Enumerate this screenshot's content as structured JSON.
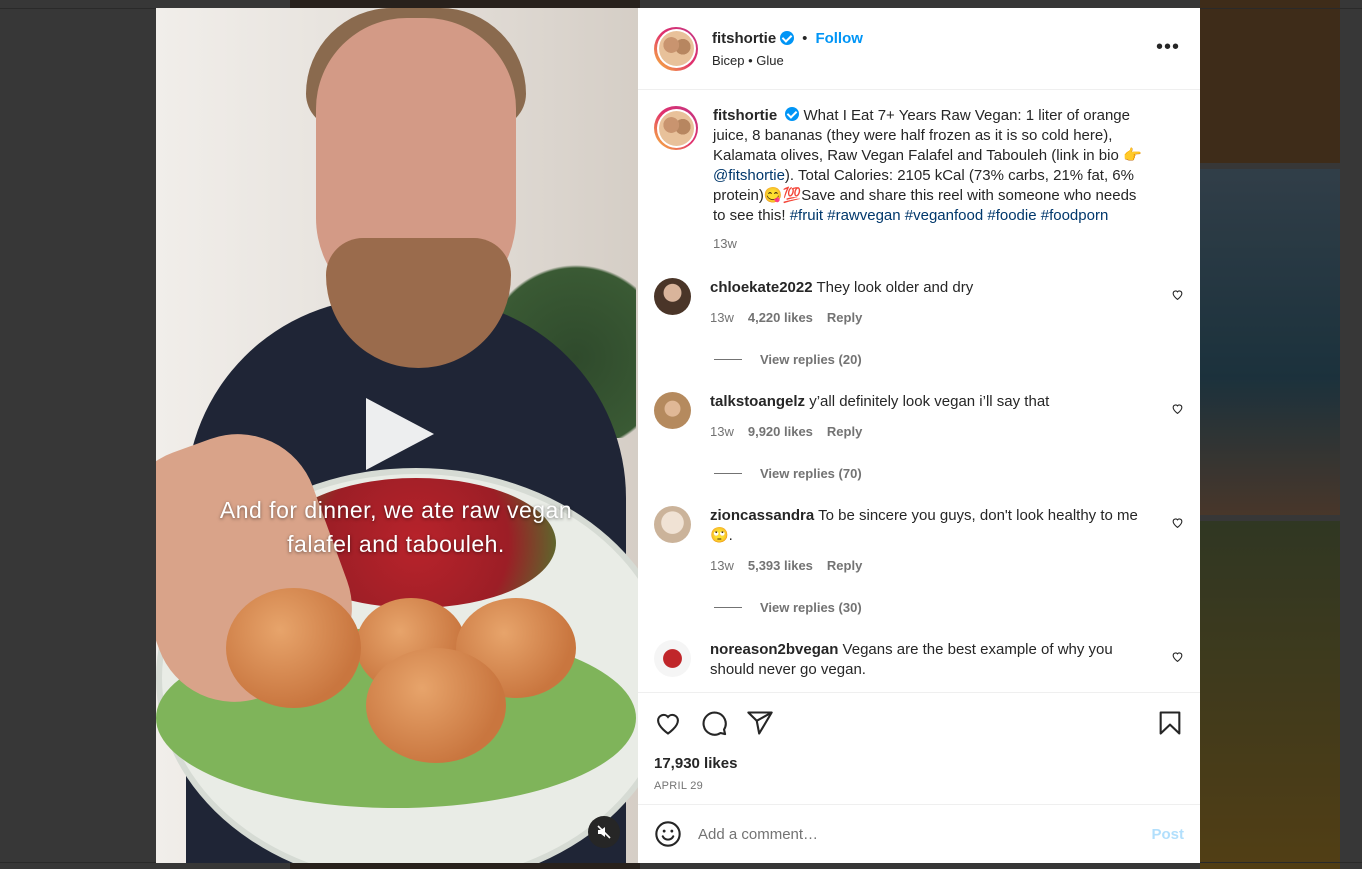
{
  "post": {
    "username": "fitshortie",
    "follow_label": "Follow",
    "separator": "•",
    "audio": "Bicep • Glue",
    "more_label": "•••",
    "video_caption": "And for dinner, we ate raw vegan falafel and tabouleh.",
    "caption_parts": {
      "text1": "What I Eat 7+ Years Raw Vegan: 1 liter of orange juice, 8 bananas (they were half frozen as it is so cold here), Kalamata olives, Raw Vegan Falafel and Tabouleh (link in bio 👉 ",
      "mention": "@fitshortie",
      "text2": "). Total Calories: 2105 kCal (73% carbs, 21% fat, 6% protein)😋💯Save and share this reel with someone who needs to see this! ",
      "hashtags": "#fruit #rawvegan #veganfood #foodie #foodporn"
    },
    "caption_time": "13w",
    "likes": "17,930 likes",
    "date": "APRIL 29"
  },
  "comments": [
    {
      "username": "chloekate2022",
      "text": "They look older and dry",
      "time": "13w",
      "likes": "4,220 likes",
      "reply": "Reply",
      "view_replies": "View replies (20)",
      "avatar_color": "#8c6d5b"
    },
    {
      "username": "talkstoangelz",
      "text": "y’all definitely look vegan i’ll say that",
      "time": "13w",
      "likes": "9,920 likes",
      "reply": "Reply",
      "view_replies": "View replies (70)",
      "avatar_color": "#b58a5e"
    },
    {
      "username": "zioncassandra",
      "text": "To be sincere you guys, don't look healthy to me 🙄.",
      "time": "13w",
      "likes": "5,393 likes",
      "reply": "Reply",
      "view_replies": "View replies (30)",
      "avatar_color": "#d6c4b0"
    },
    {
      "username": "noreason2bvegan",
      "text": "Vegans are the best example of why you should never go vegan.",
      "avatar_color": "#c0262a"
    }
  ],
  "add_comment": {
    "placeholder": "Add a comment…",
    "post_label": "Post"
  },
  "icons": {
    "like": "heart-icon",
    "comment": "comment-icon",
    "share": "share-icon",
    "save": "bookmark-icon",
    "emoji": "emoji-icon",
    "mute": "muted-speaker-icon",
    "play": "play-icon"
  },
  "colors": {
    "accent": "#0095f6",
    "hashtag": "#00376b",
    "muted_text": "#737373",
    "post_disabled": "#b2dffc"
  }
}
